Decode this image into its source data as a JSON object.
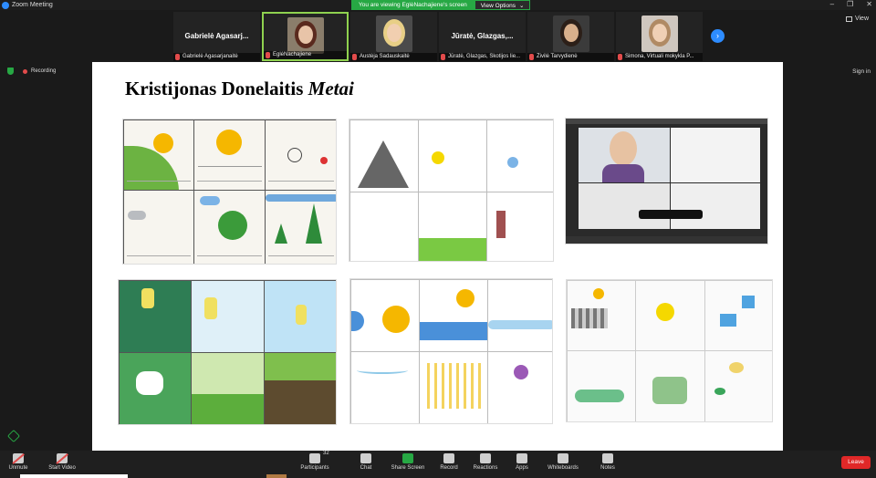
{
  "window": {
    "title": "Zoom Meeting",
    "controls": [
      "–",
      "❐",
      "✕"
    ]
  },
  "share_banner": {
    "message": "You are viewing EglėNachajiene's screen",
    "options_label": "View Options",
    "options_caret": "⌄"
  },
  "view_button": {
    "label": "View"
  },
  "participants": [
    {
      "big_name": "Gabrielė Agasarj...",
      "name": "Gabrielė Agasarjanaitė",
      "video": false
    },
    {
      "big_name": "",
      "name": "EglėNachajiene",
      "video": true,
      "active": true,
      "bg": "#8a7d6b",
      "skin": "#e8c4a8",
      "hair": "#5a2a1e"
    },
    {
      "big_name": "",
      "name": "Austėja Sadauskaitė",
      "video": true,
      "bg": "#4b4b4b",
      "skin": "#f1cfb0",
      "hair": "#e8cf86"
    },
    {
      "big_name": "Jūratė, Glazgas,...",
      "name": "Jūratė, Glazgas, Škotijos lie...",
      "video": false
    },
    {
      "big_name": "",
      "name": "Živilė Tarvydienė",
      "video": true,
      "bg": "#3b3b3b",
      "skin": "#d9b08c",
      "hair": "#2c1f18"
    },
    {
      "big_name": "",
      "name": "Simona, Virtuali mokykla P...",
      "video": true,
      "bg": "#cfc7bf",
      "skin": "#f0d0b5",
      "hair": "#b08a64"
    }
  ],
  "next_arrow": "›",
  "recording": {
    "label": "Recording"
  },
  "sign_in": "Sign in",
  "slide": {
    "title_plain": "Kristijonas Donelaitis ",
    "title_italic": "Metai"
  },
  "colors": {
    "accent_green": "#27a844",
    "zoom_blue": "#2d8cff",
    "leave_red": "#e02828"
  },
  "toolbar": {
    "items": [
      {
        "label": "Unmute",
        "icon": "mic-off-icon"
      },
      {
        "label": "Start Video",
        "icon": "video-off-icon"
      },
      {
        "label": "Participants",
        "icon": "participants-icon",
        "count": "32"
      },
      {
        "label": "Chat",
        "icon": "chat-icon"
      },
      {
        "label": "Share Screen",
        "icon": "share-screen-icon"
      },
      {
        "label": "Record",
        "icon": "record-icon"
      },
      {
        "label": "Reactions",
        "icon": "reactions-icon"
      },
      {
        "label": "Apps",
        "icon": "apps-icon"
      },
      {
        "label": "Whiteboards",
        "icon": "whiteboard-icon"
      },
      {
        "label": "Notes",
        "icon": "notes-icon"
      }
    ],
    "leave_label": "Leave"
  }
}
